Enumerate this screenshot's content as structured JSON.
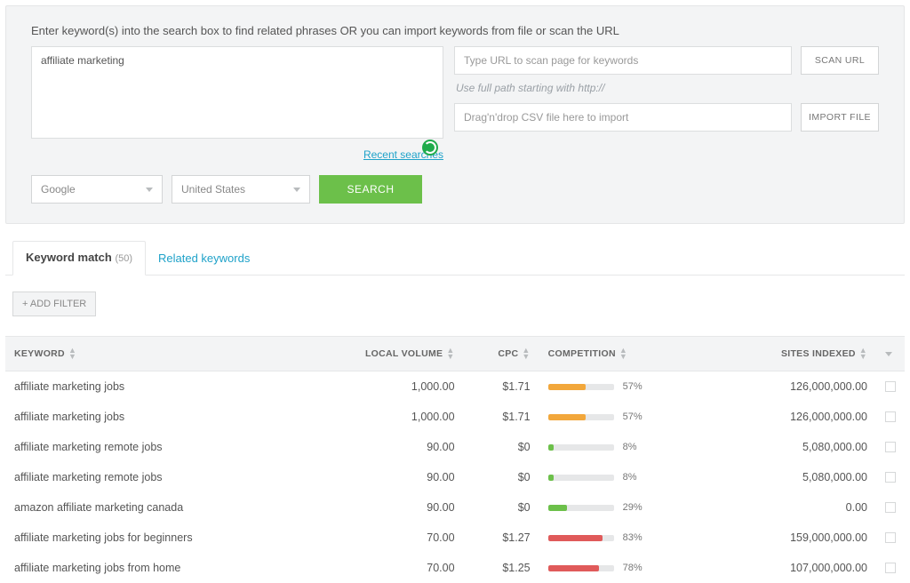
{
  "intro": "Enter keyword(s) into the search box to find related phrases OR you can import keywords from file or scan the URL",
  "keyword_input": "affiliate marketing",
  "recent_link": "Recent searches",
  "url_input_placeholder": "Type URL to scan page for keywords",
  "scan_url_btn": "SCAN URL",
  "url_hint": "Use full path starting with http://",
  "csv_placeholder": "Drag'n'drop CSV file here to import",
  "import_btn": "IMPORT FILE",
  "engine_select": "Google",
  "country_select": "United States",
  "search_btn": "SEARCH",
  "tabs": {
    "match_label": "Keyword match",
    "match_count": "(50)",
    "related_label": "Related keywords"
  },
  "add_filter_btn": "+ ADD FILTER",
  "columns": {
    "keyword": "KEYWORD",
    "local_volume": "LOCAL VOLUME",
    "cpc": "CPC",
    "competition": "COMPETITION",
    "sites_indexed": "SITES INDEXED"
  },
  "rows": [
    {
      "keyword": "affiliate marketing jobs",
      "volume": "1,000.00",
      "cpc": "$1.71",
      "comp_pct": 57,
      "comp_band": "mid",
      "sites": "126,000,000.00"
    },
    {
      "keyword": "affiliate marketing jobs",
      "volume": "1,000.00",
      "cpc": "$1.71",
      "comp_pct": 57,
      "comp_band": "mid",
      "sites": "126,000,000.00"
    },
    {
      "keyword": "affiliate marketing remote jobs",
      "volume": "90.00",
      "cpc": "$0",
      "comp_pct": 8,
      "comp_band": "low",
      "sites": "5,080,000.00"
    },
    {
      "keyword": "affiliate marketing remote jobs",
      "volume": "90.00",
      "cpc": "$0",
      "comp_pct": 8,
      "comp_band": "low",
      "sites": "5,080,000.00"
    },
    {
      "keyword": "amazon affiliate marketing canada",
      "volume": "90.00",
      "cpc": "$0",
      "comp_pct": 29,
      "comp_band": "low",
      "sites": "0.00"
    },
    {
      "keyword": "affiliate marketing jobs for beginners",
      "volume": "70.00",
      "cpc": "$1.27",
      "comp_pct": 83,
      "comp_band": "high",
      "sites": "159,000,000.00"
    },
    {
      "keyword": "affiliate marketing jobs from home",
      "volume": "70.00",
      "cpc": "$1.25",
      "comp_pct": 78,
      "comp_band": "high",
      "sites": "107,000,000.00"
    }
  ]
}
